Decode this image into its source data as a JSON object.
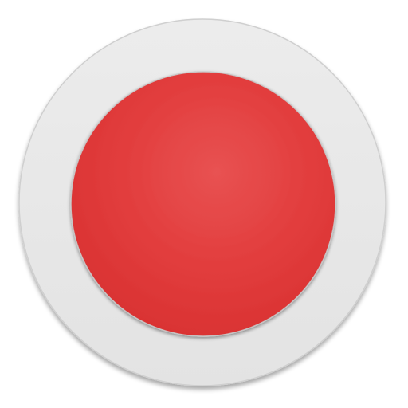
{
  "icon": {
    "name": "record-button-icon",
    "colors": {
      "background": "#ffffff",
      "rim_light": "#ececec",
      "rim_mid": "#e3e3e3",
      "rim_edge": "#cfcfcf",
      "red_highlight": "#e85252",
      "red_mid": "#e23d3d",
      "red_dark": "#d93232"
    }
  }
}
